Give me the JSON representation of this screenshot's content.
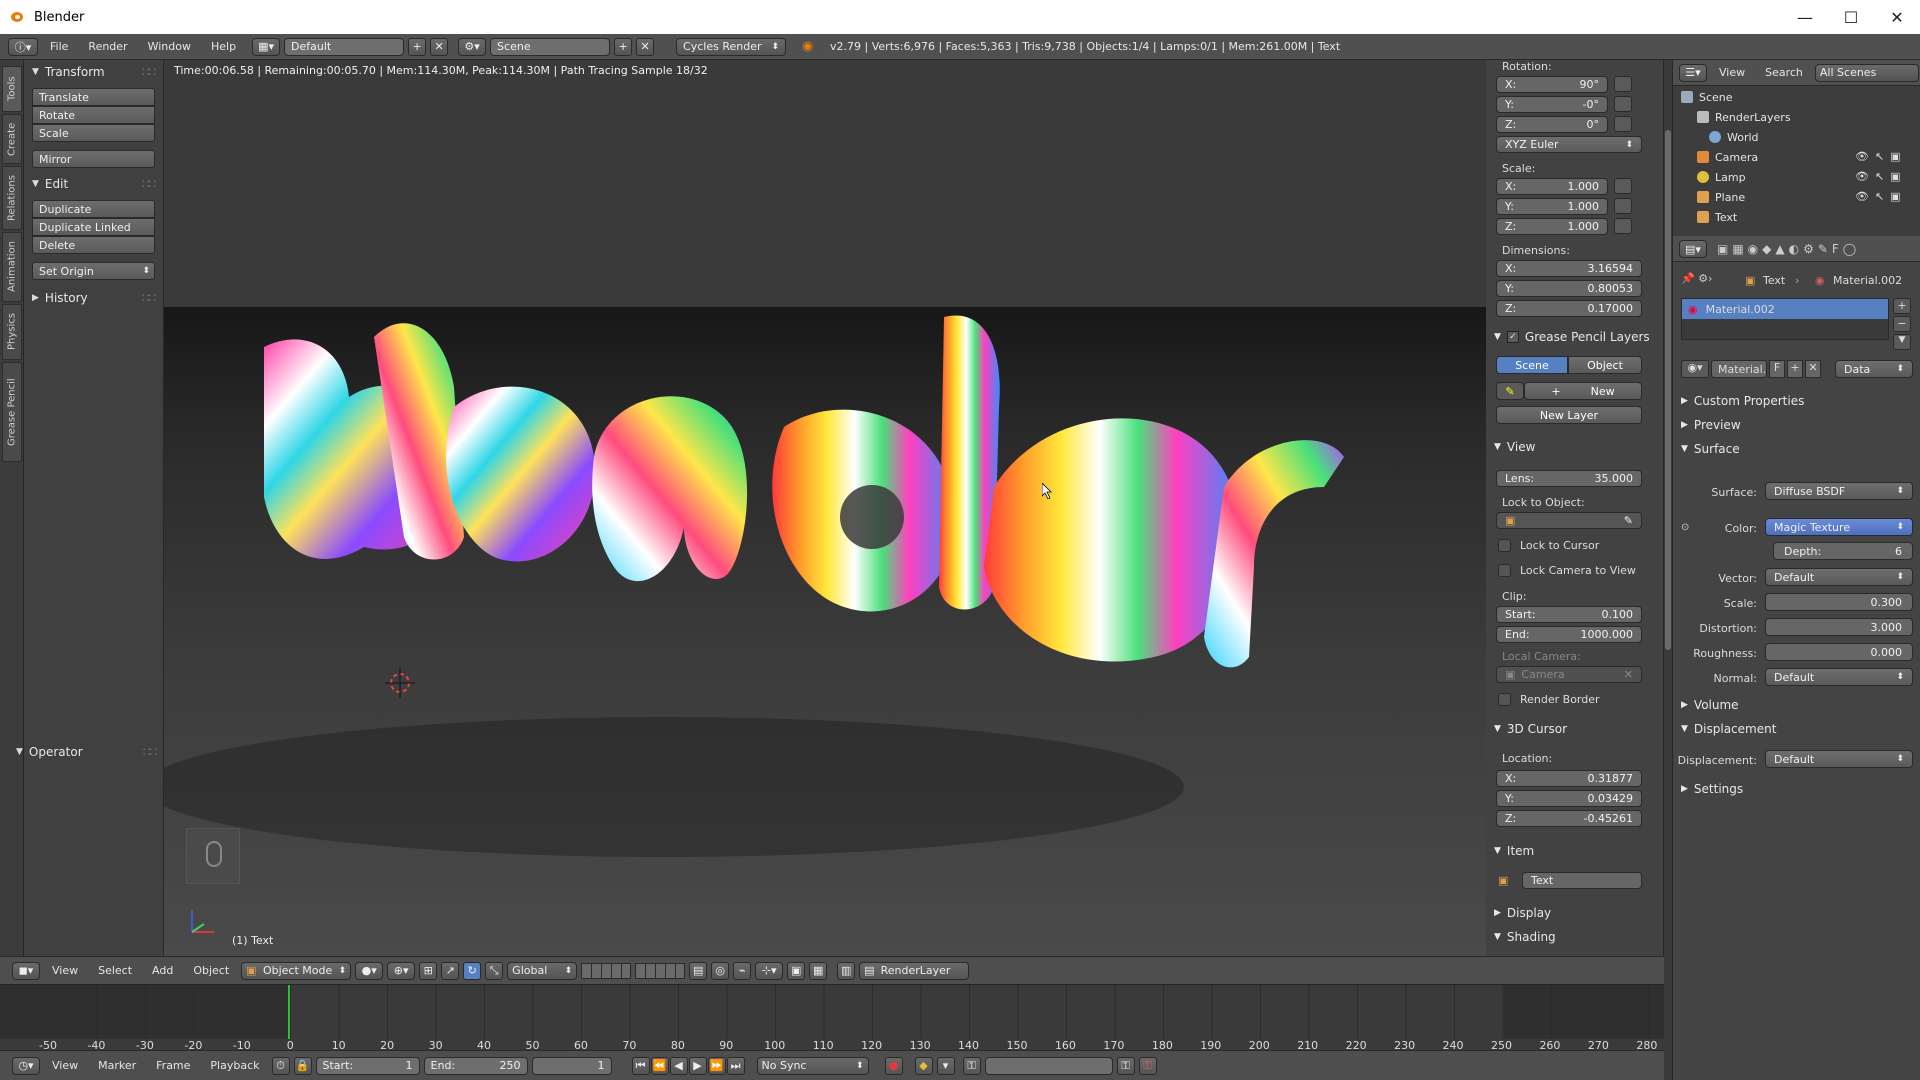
{
  "window": {
    "title": "Blender",
    "controls": [
      "—",
      "☐",
      "✕"
    ]
  },
  "info_header": {
    "menus": [
      "File",
      "Render",
      "Window",
      "Help"
    ],
    "layout": "Default",
    "scene": "Scene",
    "engine": "Cycles Render",
    "stats": "v2.79 | Verts:6,976 | Faces:5,363 | Tris:9,738 | Objects:1/4 | Lamps:0/1 | Mem:261.00M | Text"
  },
  "left_tabs": [
    "Tools",
    "Create",
    "Relations",
    "Animation",
    "Physics",
    "Grease Pencil"
  ],
  "tool_shelf": {
    "transform": {
      "title": "Transform",
      "buttons": [
        "Translate",
        "Rotate",
        "Scale",
        "Mirror"
      ]
    },
    "edit": {
      "title": "Edit",
      "buttons": [
        "Duplicate",
        "Duplicate Linked",
        "Delete"
      ],
      "set_origin": "Set Origin"
    },
    "history": "History",
    "operator": "Operator"
  },
  "viewport": {
    "render_info": "Time:00:06.58 | Remaining:00:05.70 | Mem:114.30M, Peak:114.30M | Path Tracing Sample 18/32",
    "object_label": "(1) Text"
  },
  "n_panel": {
    "rotation_label": "Rotation:",
    "rotation": [
      {
        "k": "X:",
        "v": "90°"
      },
      {
        "k": "Y:",
        "v": "-0°"
      },
      {
        "k": "Z:",
        "v": "0°"
      }
    ],
    "rotation_mode": "XYZ Euler",
    "scale_label": "Scale:",
    "scale": [
      {
        "k": "X:",
        "v": "1.000"
      },
      {
        "k": "Y:",
        "v": "1.000"
      },
      {
        "k": "Z:",
        "v": "1.000"
      }
    ],
    "dimensions_label": "Dimensions:",
    "dimensions": [
      {
        "k": "X:",
        "v": "3.16594"
      },
      {
        "k": "Y:",
        "v": "0.80053"
      },
      {
        "k": "Z:",
        "v": "0.17000"
      }
    ],
    "grease_pencil": {
      "title": "Grease Pencil Layers",
      "scene": "Scene",
      "object": "Object",
      "new": "New",
      "new_layer": "New Layer"
    },
    "view": {
      "title": "View",
      "lens_k": "Lens:",
      "lens_v": "35.000",
      "lock_to_object": "Lock to Object:",
      "lock_to_cursor": "Lock to Cursor",
      "lock_camera_to_view": "Lock Camera to View",
      "clip": "Clip:",
      "start_k": "Start:",
      "start_v": "0.100",
      "end_k": "End:",
      "end_v": "1000.000",
      "local_camera": "Local Camera:",
      "camera": "Camera",
      "render_border": "Render Border"
    },
    "cursor": {
      "title": "3D Cursor",
      "location": "Location:",
      "x_k": "X:",
      "x_v": "0.31877",
      "y_k": "Y:",
      "y_v": "0.03429",
      "z_k": "Z:",
      "z_v": "-0.45261"
    },
    "item": {
      "title": "Item",
      "name": "Text"
    },
    "display": "Display",
    "shading": "Shading"
  },
  "outliner": {
    "view": "View",
    "search": "Search",
    "filter": "All Scenes",
    "items": [
      "Scene",
      "RenderLayers",
      "World",
      "Camera",
      "Lamp",
      "Plane",
      "Text"
    ]
  },
  "properties": {
    "breadcrumb_obj": "Text",
    "breadcrumb_mat": "Material.002",
    "material_slot": "Material.002",
    "material_field": "Material.",
    "f_label": "F",
    "data": "Data",
    "custom_properties": "Custom Properties",
    "preview": "Preview",
    "surface_title": "Surface",
    "surface_label": "Surface:",
    "surface_value": "Diffuse BSDF",
    "color_label": "Color:",
    "color_value": "Magic Texture",
    "depth_k": "Depth:",
    "depth_v": "6",
    "vector_label": "Vector:",
    "vector_value": "Default",
    "scale_label": "Scale:",
    "scale_value": "0.300",
    "distortion_label": "Distortion:",
    "distortion_value": "3.000",
    "roughness_label": "Roughness:",
    "roughness_value": "0.000",
    "normal_label": "Normal:",
    "normal_value": "Default",
    "volume": "Volume",
    "displacement_title": "Displacement",
    "displacement_label": "Displacement:",
    "displacement_value": "Default",
    "settings": "Settings"
  },
  "view_header": {
    "menus": [
      "View",
      "Select",
      "Add",
      "Object"
    ],
    "mode": "Object Mode",
    "orientation": "Global",
    "render_layer": "RenderLayer"
  },
  "timeline": {
    "ticks": [
      "-50",
      "-40",
      "-30",
      "-20",
      "-10",
      "0",
      "10",
      "20",
      "30",
      "40",
      "50",
      "60",
      "70",
      "80",
      "90",
      "100",
      "110",
      "120",
      "130",
      "140",
      "150",
      "160",
      "170",
      "180",
      "190",
      "200",
      "210",
      "220",
      "230",
      "240",
      "250",
      "260",
      "270",
      "280"
    ],
    "menus": [
      "View",
      "Marker",
      "Frame",
      "Playback"
    ],
    "start_k": "Start:",
    "start_v": "1",
    "end_k": "End:",
    "end_v": "250",
    "current": "1",
    "sync": "No Sync"
  },
  "colors": {
    "accent_blue": "#5680c2",
    "playhead": "#2fbe3a",
    "bg": "#3a3a3a"
  }
}
